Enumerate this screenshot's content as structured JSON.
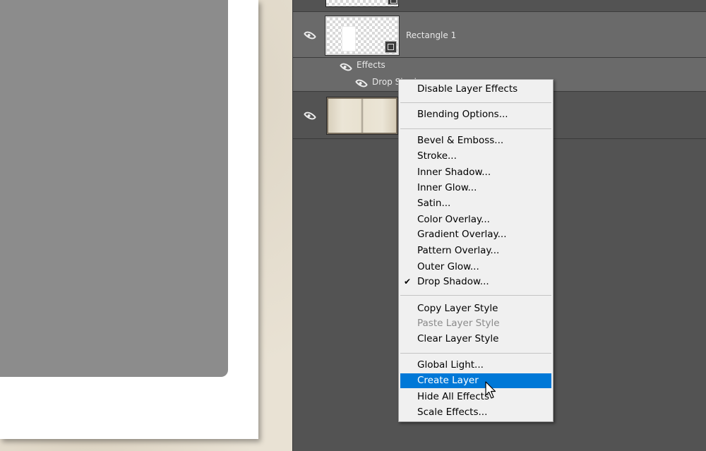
{
  "canvas": {
    "paper_color": "#ffffff",
    "shape_color": "#8c8c8c"
  },
  "layers_panel": {
    "background": "#535353",
    "layers": [
      {
        "name": "",
        "visible": false
      },
      {
        "name": "Rectangle 1",
        "visible": true,
        "selected": true
      },
      {
        "name": "",
        "visible": true
      }
    ],
    "effects_label": "Effects",
    "effect_item_label": "Drop Shadow"
  },
  "context_menu": {
    "highlight_color": "#0078d7",
    "groups": [
      {
        "items": [
          {
            "label": "Disable Layer Effects"
          }
        ]
      },
      {
        "items": [
          {
            "label": "Blending Options..."
          }
        ]
      },
      {
        "items": [
          {
            "label": "Bevel & Emboss..."
          },
          {
            "label": "Stroke..."
          },
          {
            "label": "Inner Shadow..."
          },
          {
            "label": "Inner Glow..."
          },
          {
            "label": "Satin..."
          },
          {
            "label": "Color Overlay..."
          },
          {
            "label": "Gradient Overlay..."
          },
          {
            "label": "Pattern Overlay..."
          },
          {
            "label": "Outer Glow..."
          },
          {
            "label": "Drop Shadow...",
            "checked": true,
            "check_mark": "✔"
          }
        ]
      },
      {
        "items": [
          {
            "label": "Copy Layer Style"
          },
          {
            "label": "Paste Layer Style",
            "disabled": true
          },
          {
            "label": "Clear Layer Style"
          }
        ]
      },
      {
        "items": [
          {
            "label": "Global Light..."
          },
          {
            "label": "Create Layer",
            "highlighted": true
          },
          {
            "label": "Hide All Effects"
          },
          {
            "label": "Scale Effects..."
          }
        ]
      }
    ]
  },
  "icons": {
    "visibility": "eye-icon",
    "vector_mask": "vector-mask-icon",
    "pointer": "mouse-pointer-icon"
  }
}
